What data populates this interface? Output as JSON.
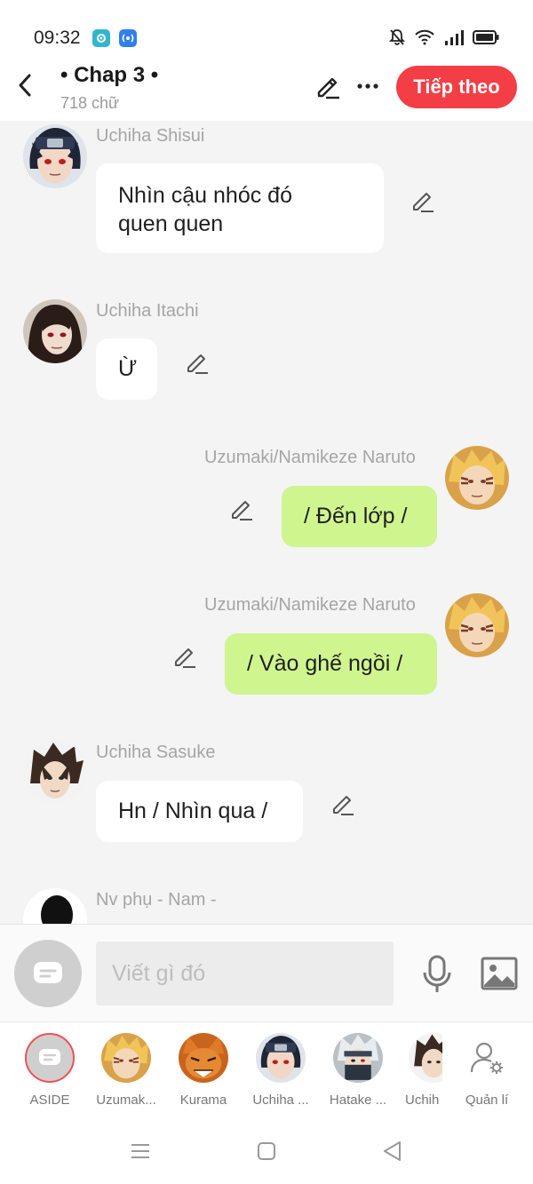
{
  "status_bar": {
    "time": "09:32"
  },
  "header": {
    "title": "• Chap 3 •",
    "word_count": "718 chữ",
    "next_label": "Tiếp theo",
    "accent_color": "#f33e46"
  },
  "messages": [
    {
      "sender": "Uchiha Shisui",
      "side": "left",
      "lines": [
        "Nhìn cậu nhóc đó",
        "quen quen"
      ],
      "avatar": "shisui-avatar"
    },
    {
      "sender": "Uchiha Itachi",
      "side": "left",
      "lines": [
        "Ừ"
      ],
      "avatar": "itachi-avatar"
    },
    {
      "sender": "Uzumaki/Namikeze Naruto",
      "side": "right",
      "lines": [
        "/ Đến lớp /"
      ],
      "avatar": "naruto-avatar"
    },
    {
      "sender": "Uzumaki/Namikeze Naruto",
      "side": "right",
      "lines": [
        "/ Vào ghế ngồi /"
      ],
      "avatar": "naruto-avatar"
    },
    {
      "sender": "Uchiha Sasuke",
      "side": "left",
      "lines": [
        "Hn / Nhìn qua /"
      ],
      "avatar": "sasuke-avatar"
    },
    {
      "sender": "Nv phụ - Nam -",
      "side": "left",
      "lines": [],
      "avatar": "silhouette-avatar"
    }
  ],
  "composer": {
    "placeholder": "Viết gì đó"
  },
  "characters": [
    {
      "label": "ASIDE",
      "icon": "aside-icon"
    },
    {
      "label": "Uzumak...",
      "icon": "naruto-avatar"
    },
    {
      "label": "Kurama",
      "icon": "kurama-avatar"
    },
    {
      "label": "Uchiha ...",
      "icon": "shisui-avatar"
    },
    {
      "label": "Hatake ...",
      "icon": "kakashi-avatar"
    },
    {
      "label": "Uchih",
      "icon": "sasuke-avatar"
    },
    {
      "label": "Quản lí",
      "icon": "manage-icon"
    }
  ],
  "colors": {
    "right_bubble": "#cff58f",
    "left_bubble": "#ffffff",
    "background": "#f4f4f4"
  }
}
